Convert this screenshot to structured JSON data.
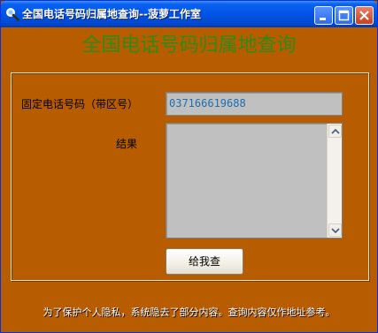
{
  "window": {
    "title": "全国电话号码归属地查询--菠萝工作室"
  },
  "app": {
    "heading": "全国电话号码归属地查询",
    "phone_label": "固定电话号码（带区号）",
    "phone_value": "037166619688",
    "result_label": "结果",
    "result_value": "",
    "query_button": "给我查",
    "footer_note": "为了保护个人隐私，系统隐去了部分内容。查询内容仅作地址参考。"
  },
  "icons": {
    "title_icon": "magnifier-icon",
    "minimize": "minimize-icon",
    "maximize": "maximize-icon",
    "close": "close-icon",
    "scroll_up": "chevron-up-icon",
    "scroll_down": "chevron-down-icon"
  },
  "colors": {
    "window_bg": "#b85c00",
    "heading": "#2e8b17",
    "phone_text": "#1f6fb0",
    "field_bg": "#c0c0c0"
  }
}
